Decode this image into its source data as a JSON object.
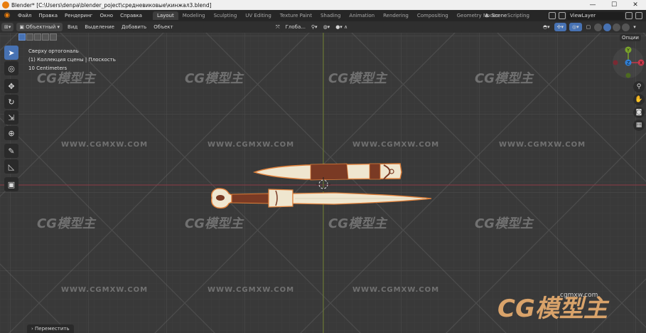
{
  "window": {
    "title": "Blender* [C:\\Users\\denpa\\blender_poject\\средневиковые\\кинжал3.blend]",
    "controls": [
      "—",
      "☐",
      "✕"
    ]
  },
  "topbar": {
    "menus": [
      "Файл",
      "Правка",
      "Рендеринг",
      "Окно",
      "Справка"
    ],
    "workspaces": [
      "Layout",
      "Modeling",
      "Sculpting",
      "UV Editing",
      "Texture Paint",
      "Shading",
      "Animation",
      "Rendering",
      "Compositing",
      "Geometry Nodes",
      "Scripting"
    ],
    "active_workspace": "Layout",
    "scene": "Scene",
    "view_layer": "ViewLayer"
  },
  "viewport_header": {
    "mode": "Объектный",
    "menus": [
      "Вид",
      "Выделение",
      "Добавить",
      "Объект"
    ],
    "transform_orientation": "Глоба...",
    "options_label": "Опции"
  },
  "overlay": {
    "view_name": "Сверху ортогональ",
    "collection": "(1) Коллекция сцены | Плоскость",
    "scale": "10 Centimeters"
  },
  "toolbar": {
    "tools": [
      {
        "name": "select-box",
        "icon": "cursor-icon",
        "active": true
      },
      {
        "name": "cursor",
        "icon": "3d-cursor-icon",
        "active": false
      },
      {
        "name": "move",
        "icon": "move-icon",
        "active": false
      },
      {
        "name": "rotate",
        "icon": "rotate-icon",
        "active": false
      },
      {
        "name": "scale",
        "icon": "scale-icon",
        "active": false
      },
      {
        "name": "transform",
        "icon": "transform-icon",
        "active": false
      },
      {
        "name": "annotate",
        "icon": "annotate-icon",
        "active": false
      },
      {
        "name": "measure",
        "icon": "measure-icon",
        "active": false
      },
      {
        "name": "add-cube",
        "icon": "add-cube-icon",
        "active": false
      }
    ]
  },
  "gizmo": {
    "axes": [
      "Y",
      "X",
      "Z"
    ]
  },
  "status": {
    "operation": "Переместить"
  },
  "watermarks": {
    "logo": "CG模型主",
    "url": "WWW.CGMXW.COM",
    "site": "cgmxw.com"
  },
  "colors": {
    "accent": "#4772b3",
    "blender_orange": "#e87d0d",
    "axis_x": "#c8384a",
    "axis_y": "#7ba52b",
    "axis_z": "#2f7fd6",
    "blade": "#efe6cf",
    "leather": "#7a3a24"
  }
}
